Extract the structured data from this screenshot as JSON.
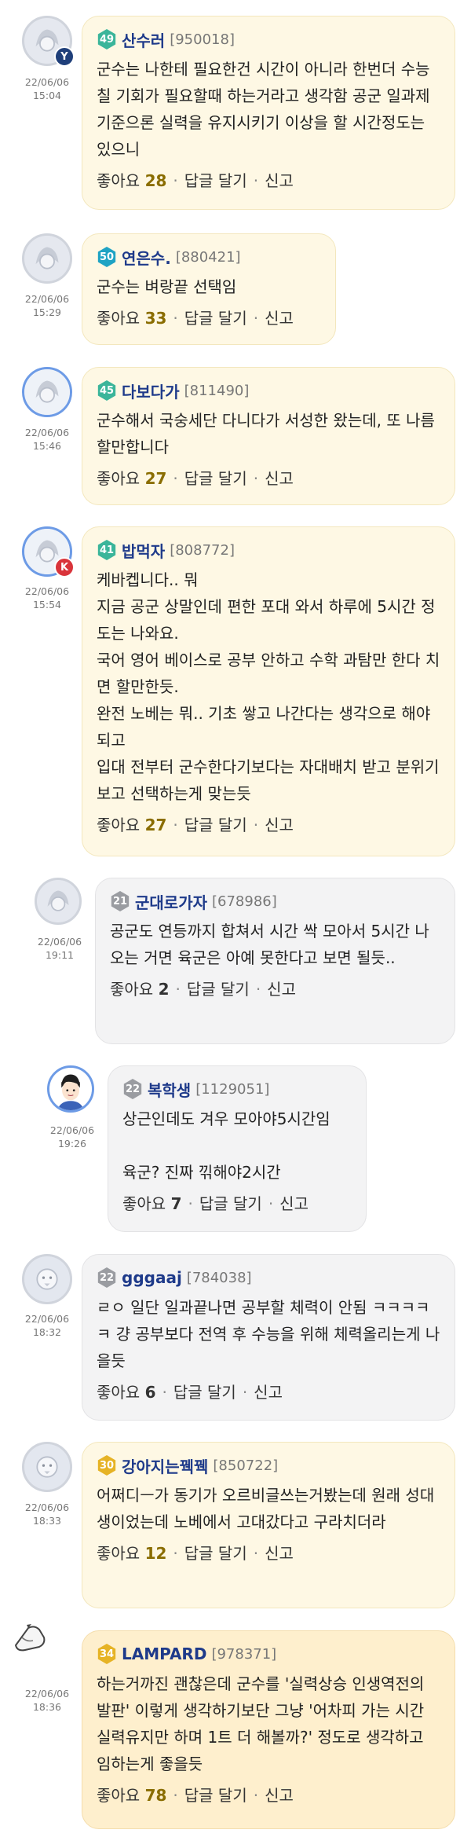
{
  "labels": {
    "like": "좋아요",
    "reply": "답글 달기",
    "report": "신고",
    "sep": "·"
  },
  "colors": {
    "nickname": "#1e3a8a",
    "count": "#8a6d00",
    "time": "#777777"
  },
  "comments": [
    {
      "level": "49",
      "nickname": "산수러",
      "uid": "[950018]",
      "date": "22/06/06",
      "time": "15:04",
      "body": "군수는 나한테 필요한건 시간이 아니라 한번더 수능 칠 기회가 필요할때 하는거라고 생각함 공군 일과제 기준으론 실력을 유지시키기 이상을 할 시간정도는 있으니",
      "likes": "28",
      "avatar_badge": "Y"
    },
    {
      "level": "50",
      "nickname": "연은수.",
      "uid": "[880421]",
      "date": "22/06/06",
      "time": "15:29",
      "body": "군수는 벼랑끝 선택임",
      "likes": "33"
    },
    {
      "level": "45",
      "nickname": "다보다가",
      "uid": "[811490]",
      "date": "22/06/06",
      "time": "15:46",
      "body": "군수해서 국숭세단 다니다가 서성한 왔는데, 또 나름 할만합니다",
      "likes": "27"
    },
    {
      "level": "41",
      "nickname": "밥먹자",
      "uid": "[808772]",
      "date": "22/06/06",
      "time": "15:54",
      "body": "케바켑니다.. 뭐\n지금 공군 상말인데 편한 포대 와서 하루에 5시간 정도는 나와요.\n국어 영어 베이스로 공부 안하고 수학 과탐만 한다 치면 할만한듯.\n완전 노베는 뭐.. 기초 쌓고 나간다는 생각으로 해야되고\n입대 전부터 군수한다기보다는 자대배치 받고 분위기 보고 선택하는게 맞는듯",
      "likes": "27",
      "avatar_badge": "K"
    },
    {
      "level": "21",
      "nickname": "군대로가자",
      "uid": "[678986]",
      "date": "22/06/06",
      "time": "19:11",
      "body": "공군도 연등까지 합쳐서 시간 싹 모아서 5시간 나오는 거면 육군은 아예 못한다고 보면 될듯..",
      "likes": "2"
    },
    {
      "level": "22",
      "nickname": "복학생",
      "uid": "[1129051]",
      "date": "22/06/06",
      "time": "19:26",
      "body": "상근인데도 겨우 모아야5시간임\n\n육군? 진짜 끾해야2시간",
      "likes": "7"
    },
    {
      "level": "22",
      "nickname": "gggaaj",
      "uid": "[784038]",
      "date": "22/06/06",
      "time": "18:32",
      "body": "ㄹㅇ 일단 일과끝나면 공부할 체력이 안됨 ㅋㅋㅋㅋㅋ 걍 공부보다 전역 후 수능을 위해 체력올리는게 나을듯",
      "likes": "6"
    },
    {
      "level": "30",
      "nickname": "강아지는꿱꿱",
      "uid": "[850722]",
      "date": "22/06/06",
      "time": "18:33",
      "body": "어쩌디ㅡ가 동기가 오르비글쓰는거봤는데 원래 성대생이었는데 노베에서 고대갔다고 구라치더라",
      "likes": "12"
    },
    {
      "level": "34",
      "nickname": "LAMPARD",
      "uid": "[978371]",
      "date": "22/06/06",
      "time": "18:36",
      "body": "하는거까진 괜찮은데 군수를 '실력상승 인생역전의 발판' 이렇게 생각하기보단 그냥 '어차피 가는 시간 실력유지만 하며 1트 더 해볼까?' 정도로 생각하고 임하는게 좋을듯",
      "likes": "78"
    }
  ]
}
